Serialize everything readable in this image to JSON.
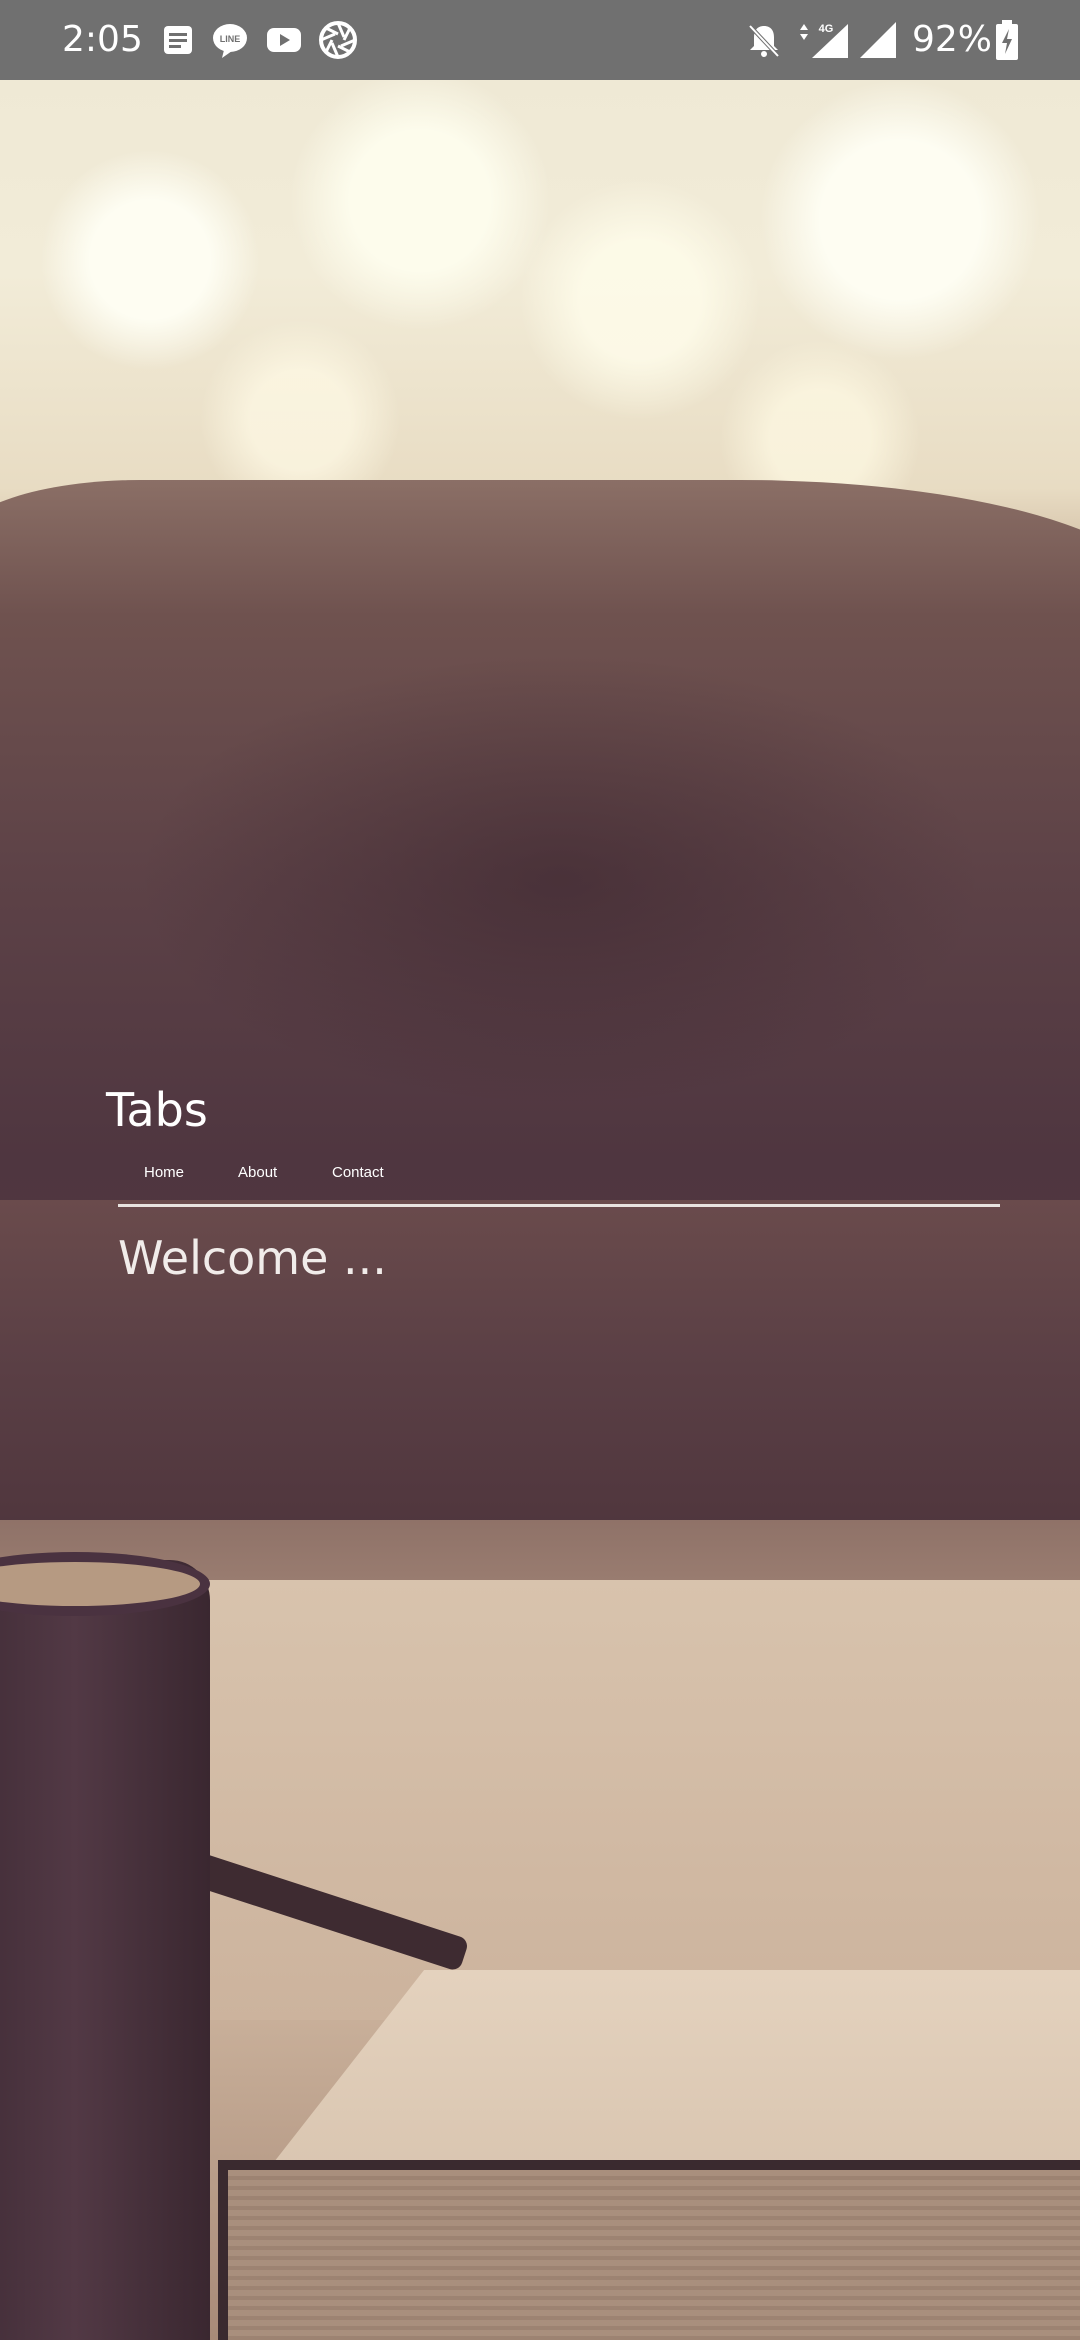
{
  "status_bar": {
    "time": "2:05",
    "battery_percent": "92%",
    "network_label": "4G",
    "icons": [
      "message-notification-icon",
      "line-app-icon",
      "youtube-icon",
      "camera-aperture-icon",
      "notifications-off-icon",
      "mobile-data-signal-icon",
      "cellular-signal-icon",
      "battery-charging-icon"
    ],
    "battery_level": 0.92
  },
  "app": {
    "title": "Tabs",
    "tabs": [
      {
        "label": "Home",
        "selected": true
      },
      {
        "label": "About",
        "selected": false
      },
      {
        "label": "Contact",
        "selected": false
      }
    ],
    "active_panel": {
      "text": "Welcome ..."
    }
  },
  "colors": {
    "status_bar_bg": "#707070",
    "text_primary": "#ffffff",
    "tab_underline": "#e8e3df"
  }
}
